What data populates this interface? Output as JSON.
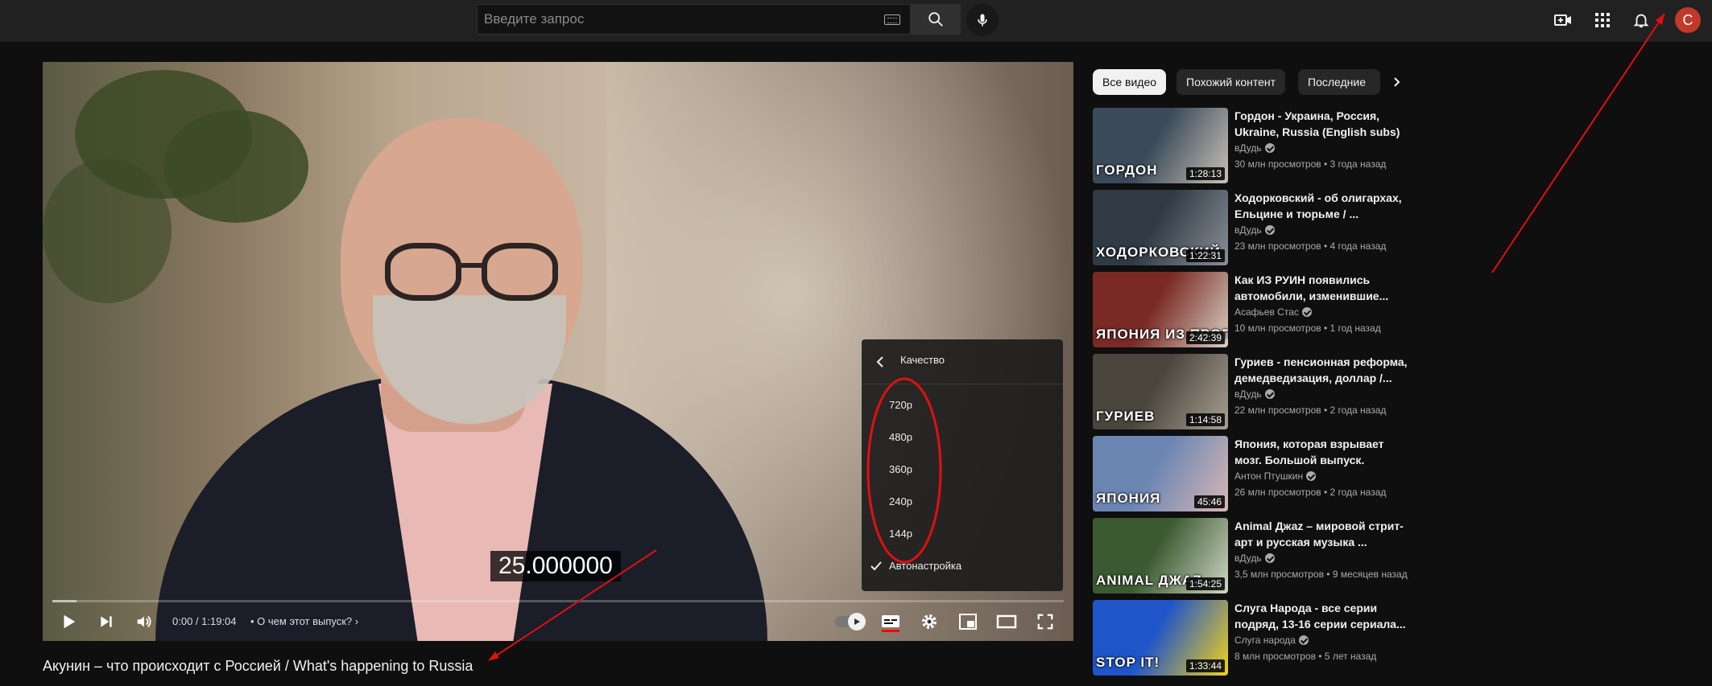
{
  "header": {
    "search": {
      "placeholder": "Введите запрос",
      "value": ""
    },
    "avatar_letter": "C",
    "icons": [
      "keyboard-icon",
      "search-icon",
      "mic-icon",
      "create-video-icon",
      "apps-grid-icon",
      "bell-icon"
    ]
  },
  "player": {
    "overlay_value": "25.000000",
    "time": "0:00 / 1:19:04",
    "chapter": "• О чем этот выпуск?",
    "progress": 0.0,
    "quality_menu": {
      "title": "Качество",
      "options": [
        "720p",
        "480p",
        "360p",
        "240p",
        "144p",
        "Автонастройка"
      ],
      "selected": "Автонастройка"
    }
  },
  "video": {
    "title": "Акунин – что происходит с Россией / What's happening to Russia"
  },
  "chips": [
    "Все видео",
    "Похожий контент",
    "Последние"
  ],
  "recommendations": [
    {
      "title": "Гордон - Украина, Россия, Ukraine, Russia (English subs)",
      "channel": "вДудь",
      "verified": true,
      "meta": "30 млн просмотров • 3 года назад",
      "duration": "1:28:13",
      "caption": "ГОРДОН",
      "colors": [
        "#3a4a5a",
        "#c9c2b8"
      ]
    },
    {
      "title": "Ходорковский - об олигархах, Ельцине и тюрьме / ...",
      "channel": "вДудь",
      "verified": true,
      "meta": "23 млн просмотров • 4 года назад",
      "duration": "1:22:31",
      "caption": "ХОДОРКОВСКИЙ",
      "colors": [
        "#2f3a45",
        "#8a8f96"
      ]
    },
    {
      "title": "Как ИЗ РУИН появились автомобили, изменившие...",
      "channel": "Асафьев Стас",
      "verified": true,
      "meta": "10 млн просмотров • 1 год назад",
      "duration": "2:42:39",
      "caption": "ЯПОНИЯ ИЗ ПРОПАСТИ К В",
      "colors": [
        "#7a2a24",
        "#d7cfc2"
      ]
    },
    {
      "title": "Гуриев - пенсионная реформа, демедведизация, доллар /...",
      "channel": "вДудь",
      "verified": true,
      "meta": "22 млн просмотров • 2 года назад",
      "duration": "1:14:58",
      "caption": "ГУРИЕВ",
      "colors": [
        "#4a463e",
        "#a89f92"
      ]
    },
    {
      "title": "Япония, которая взрывает мозг. Большой выпуск.",
      "channel": "Антон Птушкин",
      "verified": true,
      "meta": "26 млн просмотров • 2 года назад",
      "duration": "45:46",
      "caption": "ЯПОНИЯ",
      "colors": [
        "#6b86b3",
        "#d8b8b6"
      ]
    },
    {
      "title": "Animal Джаz – мировой стрит-арт и русская музыка ...",
      "channel": "вДудь",
      "verified": true,
      "meta": "3,5 млн просмотров • 9 месяцев назад",
      "duration": "1:54:25",
      "caption": "ANIMAL ДЖАZ",
      "colors": [
        "#3c5a32",
        "#cfd6c4"
      ]
    },
    {
      "title": "Слуга Народа - все серии подряд, 13-16 серии сериала...",
      "channel": "Слуга народа",
      "verified": true,
      "meta": "8 млн просмотров • 5 лет назад",
      "duration": "1:33:44",
      "caption": "STOP IT!",
      "colors": [
        "#1f55c8",
        "#f2d21c"
      ]
    }
  ],
  "colors": {
    "accent": "#ff0000",
    "annotation": "#e01010",
    "avatar": "#c0392b"
  }
}
